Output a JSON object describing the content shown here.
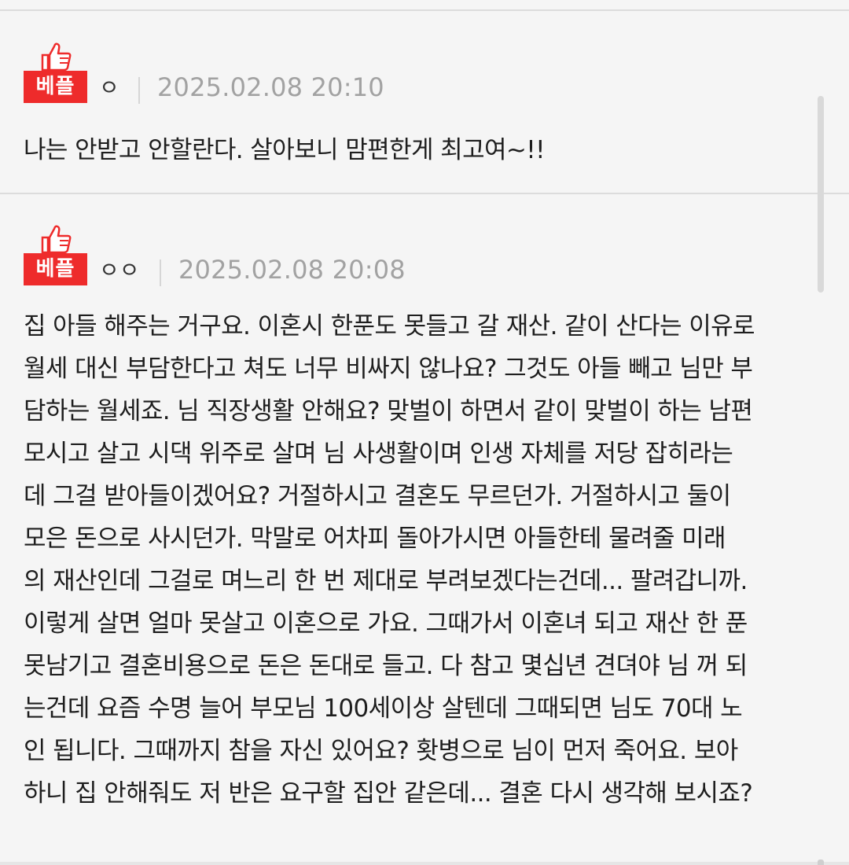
{
  "colors": {
    "badge_red": "#ee2b2b",
    "date_gray": "#a2a2a2",
    "body_text": "#1e1e1e",
    "background": "#f5f5f5"
  },
  "comments": [
    {
      "badge_label": "베플",
      "badge_icon": "thumbs-up-icon",
      "nickname": "ㅇ",
      "date": "2025.02.08 20:10",
      "lines": [
        "나는 안받고 안할란다. 살아보니 맘편한게 최고여~!!"
      ]
    },
    {
      "badge_label": "베플",
      "badge_icon": "thumbs-up-icon",
      "nickname": "ㅇㅇ",
      "date": "2025.02.08 20:08",
      "lines": [
        "집 아들 해주는 거구요. 이혼시 한푼도 못들고 갈 재산. 같이 산다는 이유로",
        "월세 대신 부담한다고 쳐도 너무 비싸지 않나요? 그것도 아들 빼고 님만 부",
        "담하는 월세죠. 님 직장생활 안해요? 맞벌이 하면서 같이 맞벌이 하는 남편",
        "모시고 살고 시댁 위주로 살며 님 사생활이며 인생 자체를 저당 잡히라는",
        "데 그걸 받아들이겠어요? 거절하시고 결혼도 무르던가. 거절하시고 둘이",
        "모은 돈으로 사시던가. 막말로 어차피 돌아가시면 아들한테 물려줄 미래",
        "의 재산인데 그걸로 며느리 한 번 제대로 부려보겠다는건데... 팔려갑니까.",
        "이렇게 살면 얼마 못살고 이혼으로 가요. 그때가서 이혼녀 되고 재산 한 푼",
        "못남기고 결혼비용으로 돈은 돈대로 들고. 다 참고 몇십년 견뎌야 님 꺼 되",
        "는건데 요즘 수명 늘어 부모님 100세이상 살텐데 그때되면 님도 70대 노",
        "인 됩니다. 그때까지 참을 자신 있어요? 홧병으로 님이 먼저 죽어요. 보아",
        "하니 집 안해줘도 저 반은 요구할 집안 같은데... 결혼 다시 생각해 보시죠?"
      ]
    }
  ]
}
